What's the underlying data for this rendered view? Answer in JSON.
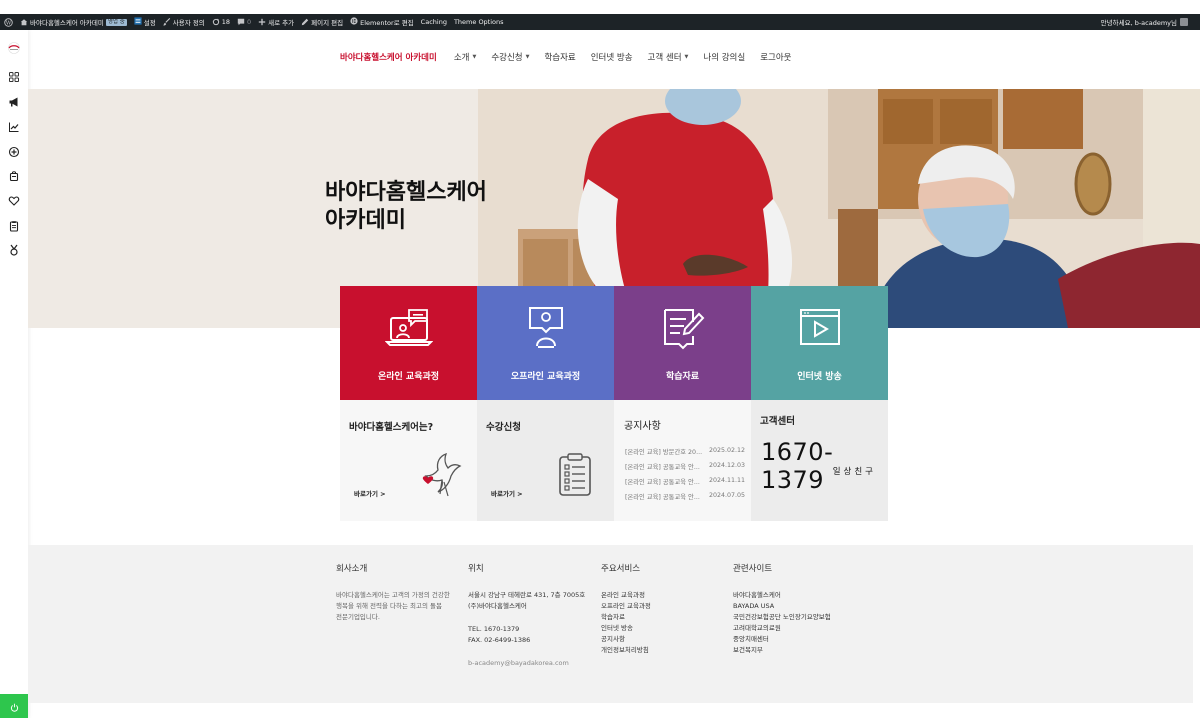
{
  "adminbar": {
    "site_name": "바야다홈헬스케어 아카데미",
    "badge": "영업 중",
    "settings": "설정",
    "customize": "사용자 정의",
    "updates_count": "18",
    "comments_count": "0",
    "new": "새로 추가",
    "edit_page": "페이지 편집",
    "elementor": "Elementor로 편집",
    "caching": "Caching",
    "theme_options": "Theme Options",
    "greeting": "안녕하세요, b-academy님"
  },
  "nav": {
    "brand": "바야다홈헬스케어 아카데미",
    "items": [
      {
        "label": "소개",
        "dropdown": true
      },
      {
        "label": "수강신청",
        "dropdown": true
      },
      {
        "label": "학습자료",
        "dropdown": false
      },
      {
        "label": "인터넷 방송",
        "dropdown": false
      },
      {
        "label": "고객 센터",
        "dropdown": true
      },
      {
        "label": "나의 강의실",
        "dropdown": false
      },
      {
        "label": "로그아웃",
        "dropdown": false
      }
    ]
  },
  "hero": {
    "title_line1": "바야다홈헬스케어",
    "title_line2": "아카데미"
  },
  "tiles": [
    {
      "label": "온라인 교육과정",
      "color": "#c8102e",
      "icon": "laptop-chat-icon"
    },
    {
      "label": "오프라인 교육과정",
      "color": "#5b6fc6",
      "icon": "presenter-icon"
    },
    {
      "label": "학습자료",
      "color": "#7b3f8a",
      "icon": "edit-document-icon"
    },
    {
      "label": "인터넷 방송",
      "color": "#55a3a3",
      "icon": "video-player-icon"
    }
  ],
  "boxes": {
    "about": {
      "title": "바야다홈헬스케어는?",
      "link": "바로가기 >"
    },
    "apply": {
      "title": "수강신청",
      "link": "바로가기 >"
    },
    "notice": {
      "title": "공지사항",
      "items": [
        {
          "text": "[온라인 교육] 방문간호 20...",
          "date": "2025.02.12"
        },
        {
          "text": "[온라인 교육] 공통교육 안...",
          "date": "2024.12.03"
        },
        {
          "text": "[온라인 교육] 공통교육 안...",
          "date": "2024.11.11"
        },
        {
          "text": "[온라인 교육] 공통교육 안...",
          "date": "2024.07.05"
        }
      ]
    },
    "support": {
      "title": "고객센터",
      "phone": "1670-1379",
      "phone_sub": "일상친구"
    }
  },
  "footer": {
    "company": {
      "heading": "회사소개",
      "lines": [
        "바야다홈헬스케어는 고객의 가정의 건강한",
        "행복을 위해 전력을 다하는 최고의 돌봄",
        "전문기업입니다."
      ]
    },
    "location": {
      "heading": "위치",
      "address1": "서울시 강남구 테헤란로 431, 7층 7005호",
      "address2": "(주)바야다홈헬스케어",
      "tel": "TEL. 1670-1379",
      "fax": "FAX. 02-6499-1386",
      "email": "b-academy@bayadakorea.com"
    },
    "services": {
      "heading": "주요서비스",
      "items": [
        "온라인 교육과정",
        "오프라인 교육과정",
        "학습자료",
        "인터넷 방송",
        "공지사항",
        "개인정보처리방침"
      ]
    },
    "related": {
      "heading": "관련사이트",
      "items": [
        "바야다홈헬스케어",
        "BAYADA USA",
        "국민건강보험공단 노인장기요양보험",
        "고려대학교의료원",
        "중앙치매센터",
        "보건복지부"
      ]
    }
  }
}
